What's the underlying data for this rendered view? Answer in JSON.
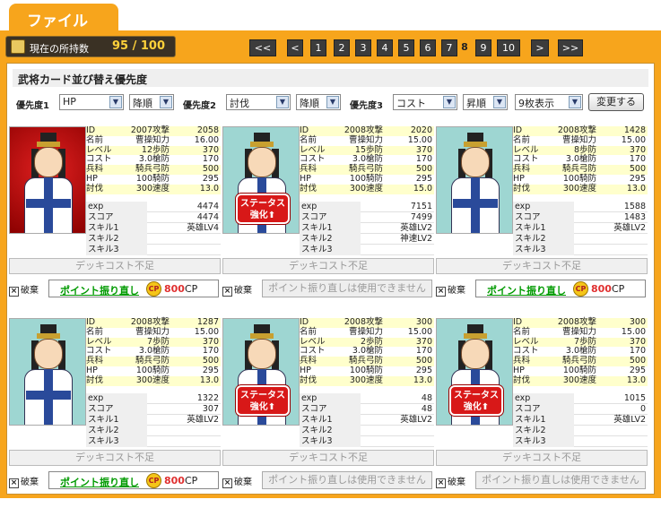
{
  "header": {
    "tab_label": "ファイル"
  },
  "holdings": {
    "label": "現在の所持数",
    "count": "95 / 100"
  },
  "pager": {
    "first": "<<",
    "prev": "<",
    "pages": [
      "1",
      "2",
      "3",
      "4",
      "5",
      "6",
      "7",
      "8",
      "9",
      "10"
    ],
    "current": "8",
    "next": ">",
    "last": ">>"
  },
  "sort": {
    "title": "武将カード並び替え優先度",
    "p1_label": "優先度1",
    "p1_value": "HP",
    "p1_order": "降順",
    "p2_label": "優先度2",
    "p2_value": "討伐",
    "p2_order": "降順",
    "p3_label": "優先度3",
    "p3_value": "コスト",
    "p3_order": "昇順",
    "display": "9枚表示",
    "change_button": "変更する"
  },
  "labels": {
    "deck_cost": "デッキコスト不足",
    "discard": "破棄",
    "realloc": "ポイント振り直し",
    "cp_icon": "CP",
    "realloc_cost": "800",
    "cp_unit": "CP",
    "realloc_disabled": "ポイント振り直しは使用できません",
    "boost_line1": "ステータス",
    "boost_line2": "強化⬆"
  },
  "cards": [
    {
      "bg": "red",
      "boost": false,
      "realloc": true,
      "stats": [
        [
          "ID",
          "2007",
          "攻撃",
          "2058"
        ],
        [
          "名前",
          "曹操",
          "知力",
          "16.00"
        ],
        [
          "レベル",
          "12",
          "歩防",
          "370"
        ],
        [
          "コスト",
          "3.0",
          "槍防",
          "170"
        ],
        [
          "兵科",
          "騎兵",
          "弓防",
          "500"
        ],
        [
          "HP",
          "100",
          "騎防",
          "295"
        ],
        [
          "討伐",
          "300",
          "速度",
          "13.0"
        ]
      ],
      "extra": [
        [
          "exp",
          "4474"
        ],
        [
          "スコア",
          "4474"
        ],
        [
          "スキル1",
          "英雄LV4"
        ],
        [
          "スキル2",
          ""
        ],
        [
          "スキル3",
          ""
        ]
      ]
    },
    {
      "bg": "teal",
      "boost": true,
      "realloc": false,
      "stats": [
        [
          "ID",
          "2008",
          "攻撃",
          "2020"
        ],
        [
          "名前",
          "曹操",
          "知力",
          "15.00"
        ],
        [
          "レベル",
          "15",
          "歩防",
          "370"
        ],
        [
          "コスト",
          "3.0",
          "槍防",
          "170"
        ],
        [
          "兵科",
          "騎兵",
          "弓防",
          "500"
        ],
        [
          "HP",
          "100",
          "騎防",
          "295"
        ],
        [
          "討伐",
          "300",
          "速度",
          "15.0"
        ]
      ],
      "extra": [
        [
          "exp",
          "7151"
        ],
        [
          "スコア",
          "7499"
        ],
        [
          "スキル1",
          "英雄LV2"
        ],
        [
          "スキル2",
          "神速LV2"
        ],
        [
          "スキル3",
          ""
        ]
      ]
    },
    {
      "bg": "teal",
      "boost": false,
      "realloc": true,
      "stats": [
        [
          "ID",
          "2008",
          "攻撃",
          "1428"
        ],
        [
          "名前",
          "曹操",
          "知力",
          "15.00"
        ],
        [
          "レベル",
          "8",
          "歩防",
          "370"
        ],
        [
          "コスト",
          "3.0",
          "槍防",
          "170"
        ],
        [
          "兵科",
          "騎兵",
          "弓防",
          "500"
        ],
        [
          "HP",
          "100",
          "騎防",
          "295"
        ],
        [
          "討伐",
          "300",
          "速度",
          "13.0"
        ]
      ],
      "extra": [
        [
          "exp",
          "1588"
        ],
        [
          "スコア",
          "1483"
        ],
        [
          "スキル1",
          "英雄LV2"
        ],
        [
          "スキル2",
          ""
        ],
        [
          "スキル3",
          ""
        ]
      ]
    },
    {
      "bg": "teal",
      "boost": false,
      "realloc": true,
      "stats": [
        [
          "ID",
          "2008",
          "攻撃",
          "1287"
        ],
        [
          "名前",
          "曹操",
          "知力",
          "15.00"
        ],
        [
          "レベル",
          "7",
          "歩防",
          "370"
        ],
        [
          "コスト",
          "3.0",
          "槍防",
          "170"
        ],
        [
          "兵科",
          "騎兵",
          "弓防",
          "500"
        ],
        [
          "HP",
          "100",
          "騎防",
          "295"
        ],
        [
          "討伐",
          "300",
          "速度",
          "13.0"
        ]
      ],
      "extra": [
        [
          "exp",
          "1322"
        ],
        [
          "スコア",
          "307"
        ],
        [
          "スキル1",
          "英雄LV2"
        ],
        [
          "スキル2",
          ""
        ],
        [
          "スキル3",
          ""
        ]
      ]
    },
    {
      "bg": "teal",
      "boost": true,
      "realloc": false,
      "stats": [
        [
          "ID",
          "2008",
          "攻撃",
          "300"
        ],
        [
          "名前",
          "曹操",
          "知力",
          "15.00"
        ],
        [
          "レベル",
          "2",
          "歩防",
          "370"
        ],
        [
          "コスト",
          "3.0",
          "槍防",
          "170"
        ],
        [
          "兵科",
          "騎兵",
          "弓防",
          "500"
        ],
        [
          "HP",
          "100",
          "騎防",
          "295"
        ],
        [
          "討伐",
          "300",
          "速度",
          "13.0"
        ]
      ],
      "extra": [
        [
          "exp",
          "48"
        ],
        [
          "スコア",
          "48"
        ],
        [
          "スキル1",
          "英雄LV2"
        ],
        [
          "スキル2",
          ""
        ],
        [
          "スキル3",
          ""
        ]
      ]
    },
    {
      "bg": "teal",
      "boost": true,
      "realloc": false,
      "stats": [
        [
          "ID",
          "2008",
          "攻撃",
          "300"
        ],
        [
          "名前",
          "曹操",
          "知力",
          "15.00"
        ],
        [
          "レベル",
          "7",
          "歩防",
          "370"
        ],
        [
          "コスト",
          "3.0",
          "槍防",
          "170"
        ],
        [
          "兵科",
          "騎兵",
          "弓防",
          "500"
        ],
        [
          "HP",
          "100",
          "騎防",
          "295"
        ],
        [
          "討伐",
          "300",
          "速度",
          "13.0"
        ]
      ],
      "extra": [
        [
          "exp",
          "1015"
        ],
        [
          "スコア",
          "0"
        ],
        [
          "スキル1",
          "英雄LV2"
        ],
        [
          "スキル2",
          ""
        ],
        [
          "スキル3",
          ""
        ]
      ]
    }
  ]
}
